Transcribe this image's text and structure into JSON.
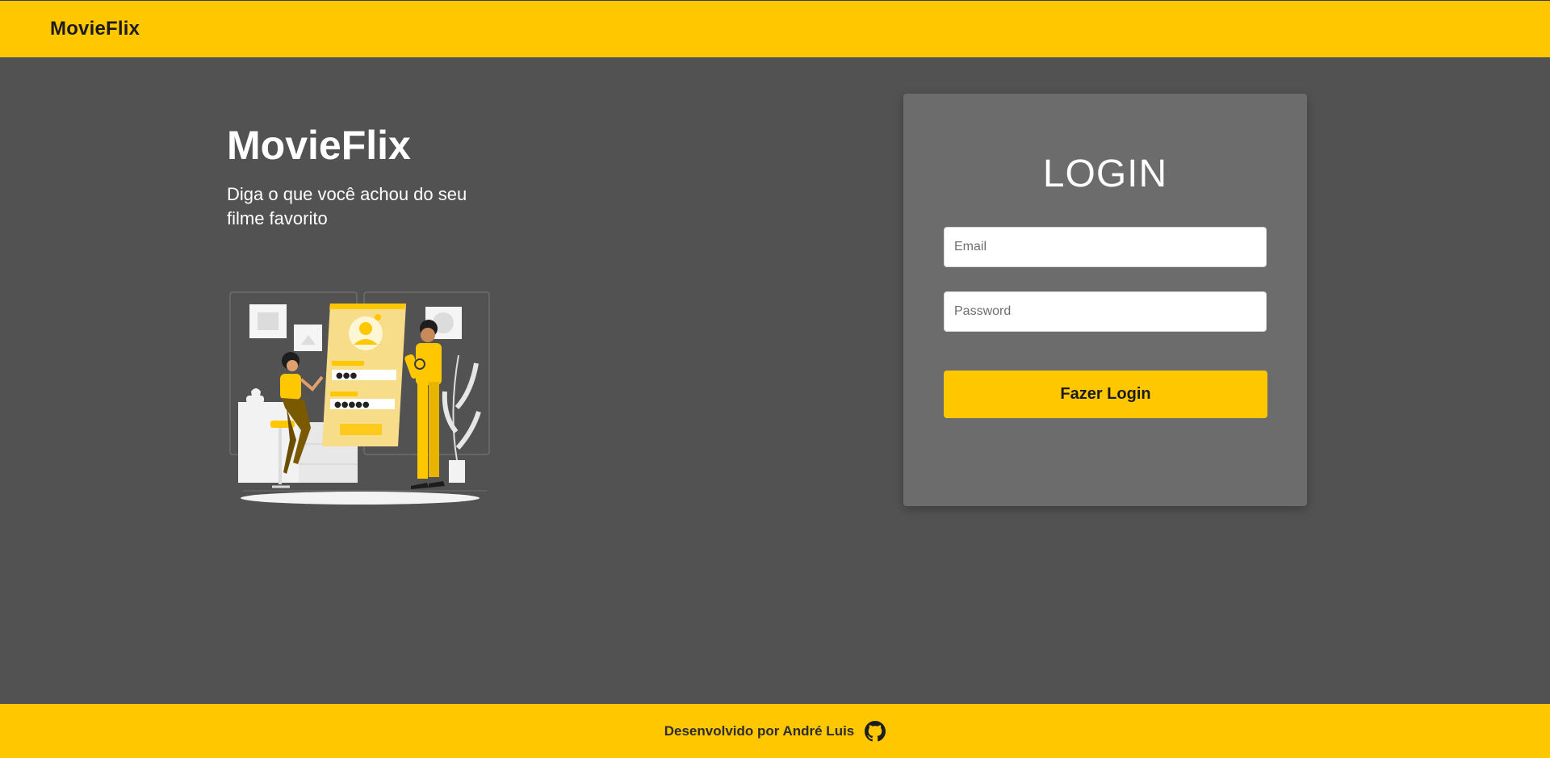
{
  "navbar": {
    "brand": "MovieFlix"
  },
  "hero": {
    "title": "MovieFlix",
    "subtitle": "Diga o que você achou do seu filme favorito"
  },
  "login": {
    "heading": "LOGIN",
    "email_placeholder": "Email",
    "email_value": "",
    "password_placeholder": "Password",
    "password_value": "",
    "submit_label": "Fazer Login"
  },
  "footer": {
    "text": "Desenvolvido por André Luis",
    "icon": "github-icon"
  },
  "colors": {
    "accent": "#FFC700",
    "background": "#525252",
    "card": "#6C6C6C"
  }
}
